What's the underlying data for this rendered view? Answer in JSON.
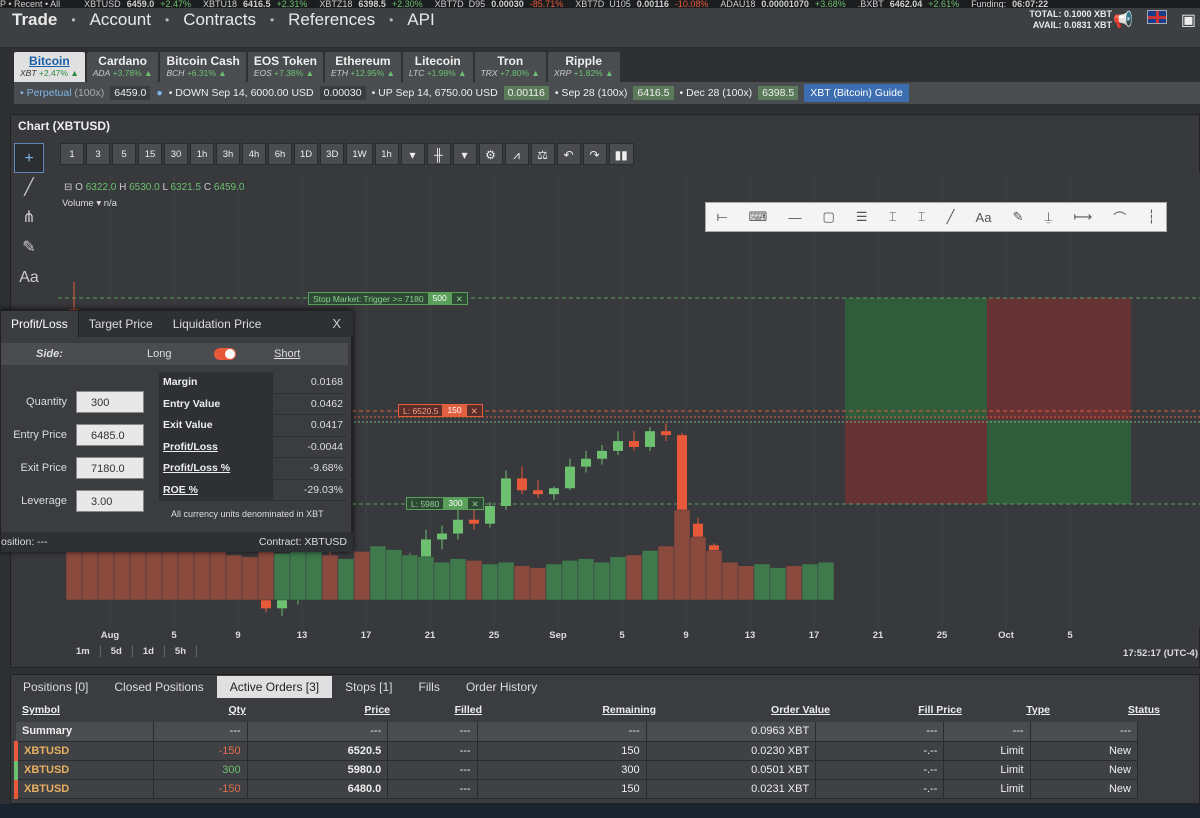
{
  "ticker": [
    {
      "name": "P • Recent • All",
      "value": ""
    },
    {
      "name": "XBTUSD",
      "value": "6459.0",
      "change": "+2.47%"
    },
    {
      "name": "XBTU18",
      "value": "6416.5",
      "change": "+2.31%"
    },
    {
      "name": "XBTZ18",
      "value": "6398.5",
      "change": "+2.30%"
    },
    {
      "name": "XBT7D_D95",
      "value": "0.00030",
      "change": "-85.71%"
    },
    {
      "name": "XBT7D_U105",
      "value": "0.00116",
      "change": "-10.08%"
    },
    {
      "name": "ADAU18",
      "value": "0.00001070",
      "change": "+3.68%"
    },
    {
      "name": ".BXBT",
      "value": "6462.04",
      "change": "+2.61%"
    },
    {
      "name": "Funding:",
      "value": "06:07:22",
      "change": ""
    }
  ],
  "nav": {
    "trade": "Trade",
    "items": [
      "Account",
      "Contracts",
      "References",
      "API"
    ]
  },
  "totals": {
    "total": "TOTAL: 0.1000 XBT",
    "avail": "AVAIL: 0.0831 XBT"
  },
  "coins": [
    {
      "name": "Bitcoin",
      "sym": "XBT",
      "chg": "+2.47%",
      "active": true
    },
    {
      "name": "Cardano",
      "sym": "ADA",
      "chg": "+3.78%"
    },
    {
      "name": "Bitcoin Cash",
      "sym": "BCH",
      "chg": "+6.31%"
    },
    {
      "name": "EOS Token",
      "sym": "EOS",
      "chg": "+7.38%"
    },
    {
      "name": "Ethereum",
      "sym": "ETH",
      "chg": "+12.95%"
    },
    {
      "name": "Litecoin",
      "sym": "LTC",
      "chg": "+1.98%"
    },
    {
      "name": "Tron",
      "sym": "TRX",
      "chg": "+7.80%"
    },
    {
      "name": "Ripple",
      "sym": "XRP",
      "chg": "+1.82%"
    }
  ],
  "contracts": {
    "perp": "• Perpetual",
    "perpx": "(100x)",
    "perpv": "6459.0",
    "down": "• DOWN Sep 14, 6000.00 USD",
    "downv": "0.00030",
    "up": "• UP Sep 14, 6750.00 USD",
    "upv": "0.00116",
    "sep": "• Sep 28 (100x)",
    "sepv": "6416.5",
    "dec": "• Dec 28 (100x)",
    "decv": "6398.5",
    "guide": "XBT (Bitcoin) Guide"
  },
  "chart": {
    "title": "Chart (XBTUSD)",
    "timeframes": [
      "1",
      "3",
      "5",
      "15",
      "30",
      "1h",
      "3h",
      "4h",
      "6h",
      "1D",
      "3D",
      "1W",
      "1h"
    ],
    "ohlc": {
      "o": "6322.0",
      "h": "6530.0",
      "l": "6321.5",
      "c": "6459.0"
    },
    "volume_label": "Volume",
    "volume_value": "n/a",
    "stop_order": {
      "label": "Stop Market: Trigger >= 7180",
      "qty": "500"
    },
    "limit_sell": {
      "label": "L: 6520.5",
      "qty": "150"
    },
    "limit_buy": {
      "label": "L: 5980",
      "qty": "300"
    },
    "xlabels": [
      "Aug",
      "5",
      "9",
      "13",
      "17",
      "21",
      "25",
      "Sep",
      "5",
      "9",
      "13",
      "17",
      "21",
      "25",
      "Oct",
      "5"
    ],
    "ranges": [
      "1m",
      "5d",
      "1d",
      "5h"
    ],
    "clock": "17:52:17 (UTC-4)",
    "draw_text_tool": "Aa"
  },
  "chart_data": {
    "type": "candlestick",
    "candles": [
      [
        6320,
        6460,
        6080,
        6100
      ],
      [
        6100,
        6180,
        5950,
        5990
      ],
      [
        5990,
        6050,
        5900,
        5940
      ],
      [
        5940,
        5960,
        5780,
        5800
      ],
      [
        5800,
        5830,
        5640,
        5660
      ],
      [
        5660,
        5700,
        5480,
        5500
      ],
      [
        5500,
        5560,
        5380,
        5420
      ],
      [
        5420,
        5440,
        5200,
        5230
      ],
      [
        5230,
        5290,
        5100,
        5150
      ],
      [
        5150,
        5170,
        5000,
        5020
      ],
      [
        5020,
        5060,
        4900,
        4940
      ],
      [
        4940,
        5000,
        4850,
        4880
      ],
      [
        4880,
        4920,
        4780,
        4800
      ],
      [
        4800,
        4900,
        4760,
        4850
      ],
      [
        4850,
        4950,
        4820,
        4900
      ],
      [
        4900,
        5050,
        4880,
        5010
      ],
      [
        5010,
        5090,
        4950,
        4970
      ],
      [
        4970,
        5020,
        4930,
        5000
      ],
      [
        5000,
        5010,
        4900,
        4920
      ],
      [
        4920,
        4980,
        4880,
        4950
      ],
      [
        4950,
        5000,
        4900,
        4980
      ],
      [
        4980,
        5080,
        4960,
        5040
      ],
      [
        5040,
        5200,
        5020,
        5150
      ],
      [
        5150,
        5220,
        5100,
        5180
      ],
      [
        5180,
        5300,
        5150,
        5250
      ],
      [
        5250,
        5300,
        5200,
        5230
      ],
      [
        5230,
        5340,
        5210,
        5320
      ],
      [
        5320,
        5500,
        5300,
        5460
      ],
      [
        5460,
        5520,
        5380,
        5400
      ],
      [
        5400,
        5450,
        5360,
        5380
      ],
      [
        5380,
        5420,
        5350,
        5410
      ],
      [
        5410,
        5560,
        5400,
        5520
      ],
      [
        5520,
        5600,
        5490,
        5560
      ],
      [
        5560,
        5630,
        5530,
        5600
      ],
      [
        5600,
        5700,
        5580,
        5650
      ],
      [
        5650,
        5700,
        5600,
        5620
      ],
      [
        5620,
        5720,
        5600,
        5700
      ],
      [
        5700,
        5740,
        5650,
        5680
      ],
      [
        5680,
        5690,
        5200,
        5230
      ],
      [
        5230,
        5260,
        5100,
        5120
      ],
      [
        5120,
        5130,
        4950,
        4990
      ],
      [
        4990,
        5020,
        4900,
        4950
      ],
      [
        4950,
        4970,
        4860,
        4880
      ],
      [
        4880,
        4920,
        4860,
        4900
      ],
      [
        4900,
        4960,
        4880,
        4940
      ],
      [
        4940,
        4960,
        4880,
        4910
      ],
      [
        4910,
        4950,
        4880,
        4930
      ],
      [
        4930,
        5010,
        4910,
        4990
      ]
    ],
    "volumes": [
      0.62,
      0.58,
      0.55,
      0.6,
      0.64,
      0.7,
      0.66,
      0.6,
      0.55,
      0.58,
      0.5,
      0.48,
      0.6,
      0.52,
      0.58,
      0.62,
      0.5,
      0.46,
      0.54,
      0.6,
      0.56,
      0.5,
      0.48,
      0.42,
      0.46,
      0.44,
      0.4,
      0.42,
      0.38,
      0.36,
      0.4,
      0.44,
      0.46,
      0.42,
      0.48,
      0.5,
      0.55,
      0.6,
      1.0,
      0.7,
      0.55,
      0.42,
      0.38,
      0.4,
      0.36,
      0.38,
      0.4,
      0.42
    ]
  },
  "drawtools": [
    "line-tool",
    "callout-tool",
    "hline-tool",
    "rect-tool",
    "lines-tool",
    "fib-tool",
    "fib2-tool",
    "ray-tool",
    "Aa",
    "brush-tool",
    "vline-tool",
    "measure-tool",
    "arc-tool",
    "pin-tool"
  ],
  "calculator": {
    "tabs": [
      "Profit/Loss",
      "Target Price",
      "Liquidation Price"
    ],
    "close": "X",
    "side_label": "Side:",
    "long": "Long",
    "short": "Short",
    "inputs": [
      {
        "label": "Quantity",
        "value": "300"
      },
      {
        "label": "Entry Price",
        "value": "6485.0"
      },
      {
        "label": "Exit Price",
        "value": "7180.0"
      },
      {
        "label": "Leverage",
        "value": "3.00"
      }
    ],
    "results": [
      {
        "k": "Margin",
        "v": "0.0168",
        "u": false
      },
      {
        "k": "Entry Value",
        "v": "0.0462",
        "u": false
      },
      {
        "k": "Exit Value",
        "v": "0.0417",
        "u": false
      },
      {
        "k": "Profit/Loss",
        "v": "-0.0044",
        "u": true
      },
      {
        "k": "Profit/Loss %",
        "v": "-9.68%",
        "u": true
      },
      {
        "k": "ROE %",
        "v": "-29.03%",
        "u": true
      }
    ],
    "note": "All currency units denominated in XBT",
    "position": "osition: ---",
    "contract": "Contract: XBTUSD"
  },
  "bottom": {
    "tabs": [
      {
        "label": "Positions [0]",
        "active": false
      },
      {
        "label": "Closed Positions",
        "active": false
      },
      {
        "label": "Active Orders [3]",
        "active": true
      },
      {
        "label": "Stops [1]",
        "active": false
      },
      {
        "label": "Fills",
        "active": false
      },
      {
        "label": "Order History",
        "active": false
      }
    ],
    "headers": [
      "Symbol",
      "Qty",
      "Price",
      "Filled",
      "Remaining",
      "Order Value",
      "Fill Price",
      "Type",
      "Status"
    ],
    "summary": [
      "Summary",
      "---",
      "---",
      "---",
      "---",
      "0.0963 XBT",
      "---",
      "---",
      "---"
    ],
    "rows": [
      [
        "XBTUSD",
        "-150",
        "6520.5",
        "---",
        "150",
        "0.0230 XBT",
        "-.--",
        "Limit",
        "New"
      ],
      [
        "XBTUSD",
        "300",
        "5980.0",
        "---",
        "300",
        "0.0501 XBT",
        "-.--",
        "Limit",
        "New"
      ],
      [
        "XBTUSD",
        "-150",
        "6480.0",
        "---",
        "150",
        "0.0231 XBT",
        "-.--",
        "Limit",
        "New"
      ]
    ]
  },
  "colors": {
    "up": "#6cc070",
    "down": "#e8593a",
    "bg": "#2e3033",
    "panel": "#3a3c3f",
    "accent": "#7fb5e8"
  }
}
